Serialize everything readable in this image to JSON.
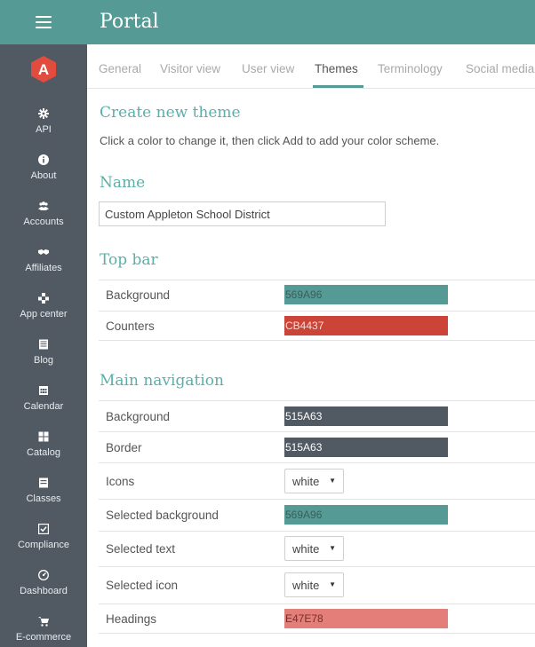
{
  "app": {
    "title": "Portal"
  },
  "colors": {
    "accent": "#569A96",
    "sidebar": "#515A63",
    "heading": "#5AAFAA",
    "logo": "#E24C3E"
  },
  "logo": {
    "letter": "A",
    "icon": "appleton-logo"
  },
  "sidebar": {
    "items": [
      {
        "label": "API",
        "icon": "gear-icon"
      },
      {
        "label": "About",
        "icon": "info-icon"
      },
      {
        "label": "Accounts",
        "icon": "users-icon"
      },
      {
        "label": "Affiliates",
        "icon": "handshake-icon"
      },
      {
        "label": "App center",
        "icon": "cubes-icon"
      },
      {
        "label": "Blog",
        "icon": "newspaper-icon"
      },
      {
        "label": "Calendar",
        "icon": "calendar-icon"
      },
      {
        "label": "Catalog",
        "icon": "grid-icon"
      },
      {
        "label": "Classes",
        "icon": "classes-icon"
      },
      {
        "label": "Compliance",
        "icon": "check-square-icon"
      },
      {
        "label": "Dashboard",
        "icon": "dashboard-icon"
      },
      {
        "label": "E-commerce",
        "icon": "cart-icon"
      }
    ]
  },
  "tabs": [
    {
      "label": "General"
    },
    {
      "label": "Visitor view"
    },
    {
      "label": "User view"
    },
    {
      "label": "Themes",
      "active": true
    },
    {
      "label": "Terminology"
    },
    {
      "label": "Social media"
    }
  ],
  "content": {
    "create_heading": "Create new theme",
    "instructions": "Click a color to change it, then click Add to add your color scheme.",
    "name_heading": "Name",
    "name_value": "Custom Appleton School District",
    "topbar_heading": "Top bar",
    "topbar_rows": [
      {
        "label": "Background",
        "type": "color",
        "value": "569A96",
        "color": "#569A96",
        "text_color": "#3a5f5c"
      },
      {
        "label": "Counters",
        "type": "color",
        "value": "CB4437",
        "color": "#CB4437",
        "text_color": "#ffd9d4"
      }
    ],
    "mainnav_heading": "Main navigation",
    "mainnav_rows": [
      {
        "label": "Background",
        "type": "color",
        "value": "515A63",
        "color": "#515A63",
        "text_color": "#ffffff"
      },
      {
        "label": "Border",
        "type": "color",
        "value": "515A63",
        "color": "#515A63",
        "text_color": "#ffffff"
      },
      {
        "label": "Icons",
        "type": "select",
        "value": "white"
      },
      {
        "label": "Selected background",
        "type": "color",
        "value": "569A96",
        "color": "#569A96",
        "text_color": "#3a5f5c"
      },
      {
        "label": "Selected text",
        "type": "select",
        "value": "white"
      },
      {
        "label": "Selected icon",
        "type": "select",
        "value": "white"
      },
      {
        "label": "Headings",
        "type": "color",
        "value": "E47E78",
        "color": "#E47E78",
        "text_color": "#7a2e29"
      }
    ]
  }
}
